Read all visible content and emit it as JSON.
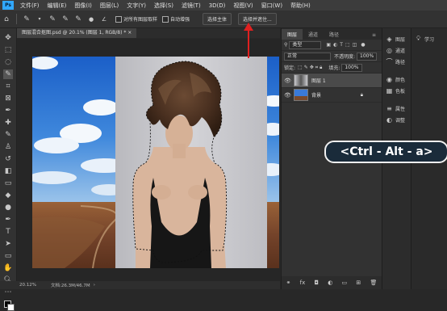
{
  "menubar": {
    "app_icon": "Ps",
    "items": [
      "文件(F)",
      "编辑(E)",
      "图像(I)",
      "图层(L)",
      "文字(Y)",
      "选择(S)",
      "滤镜(T)",
      "3D(D)",
      "视图(V)",
      "窗口(W)",
      "帮助(H)"
    ]
  },
  "options": {
    "sample_all_layers": "对所有图层取样",
    "auto_enhance": "自动增强",
    "select_subject": "选择主体",
    "select_and_mask": "选择并遮住..."
  },
  "document": {
    "tab_title": "图层混合抠图.psd @ 20.1% (图层 1, RGB/8) *",
    "zoom": "20.12%",
    "doc_info": "文档:26.3M/46.7M"
  },
  "layers_panel": {
    "tabs": [
      "图层",
      "通道",
      "路径"
    ],
    "filter": "类型",
    "blend_mode": "正常",
    "opacity_label": "不透明度:",
    "opacity_value": "100%",
    "lock_label": "锁定:",
    "fill_label": "填充:",
    "fill_value": "100%",
    "layers": [
      {
        "name": "图层 1",
        "selected": true
      },
      {
        "name": "背景",
        "selected": false
      }
    ]
  },
  "right_panels": {
    "group1": [
      "图层",
      "通道",
      "路径"
    ],
    "group2": [
      "颜色",
      "色板"
    ],
    "group3": [
      "属性",
      "调整"
    ],
    "learn": "学习"
  },
  "shortcut": "<Ctrl - Alt - a>",
  "colors": {
    "accent": "#31a8ff",
    "arrow": "#e02020"
  }
}
